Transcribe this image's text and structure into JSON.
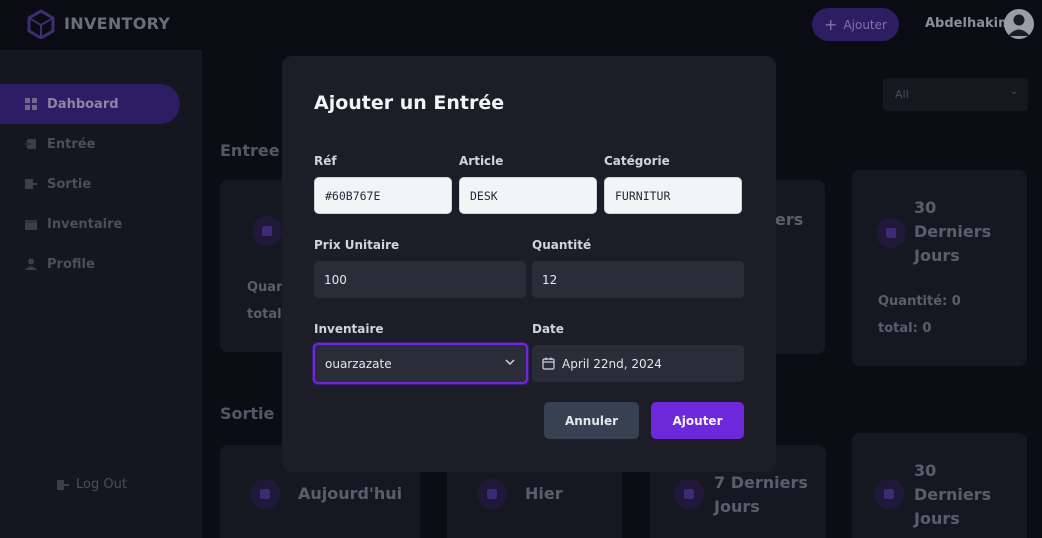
{
  "header": {
    "logo_text": "INVENTORY",
    "add_button_label": "Ajouter",
    "user_name": "Abdelhakim"
  },
  "sidebar": {
    "items": [
      {
        "label": "Dahboard",
        "icon": "dashboard-icon",
        "active": true
      },
      {
        "label": "Entrée",
        "icon": "entry-icon",
        "active": false
      },
      {
        "label": "Sortie",
        "icon": "exit-icon",
        "active": false
      },
      {
        "label": "Inventaire",
        "icon": "calendar-icon",
        "active": false
      },
      {
        "label": "Profile",
        "icon": "user-icon",
        "active": false
      }
    ],
    "logout_label": "Log Out"
  },
  "main": {
    "filter_value": "All",
    "entree": {
      "title": "Entree",
      "card_quantity_partial": "Quan",
      "card_total_partial": "total:",
      "partial_card_text": "ers",
      "last30": {
        "title": "30 Derniers Jours",
        "quantity": "Quantité: 0",
        "total": "total: 0"
      }
    },
    "sortie": {
      "title": "Sortie",
      "cards": [
        "Aujourd'hui",
        "Hier",
        "7 Derniers Jours",
        "30 Derniers Jours"
      ]
    }
  },
  "modal": {
    "title": "Ajouter un Entrée",
    "fields": {
      "ref": {
        "label": "Réf",
        "value": "#60B767E"
      },
      "article": {
        "label": "Article",
        "value": "DESK"
      },
      "categorie": {
        "label": "Catégorie",
        "value": "FURNITUR"
      },
      "prix": {
        "label": "Prix Unitaire",
        "value": "100"
      },
      "quantite": {
        "label": "Quantité",
        "value": "12"
      },
      "inventaire": {
        "label": "Inventaire",
        "value": "ouarzazate"
      },
      "date": {
        "label": "Date",
        "value": "April 22nd, 2024"
      }
    },
    "cancel_label": "Annuler",
    "submit_label": "Ajouter"
  },
  "colors": {
    "accent": "#6d28d9",
    "modal_bg": "#1c1d27",
    "page_bg": "#0f1017"
  }
}
